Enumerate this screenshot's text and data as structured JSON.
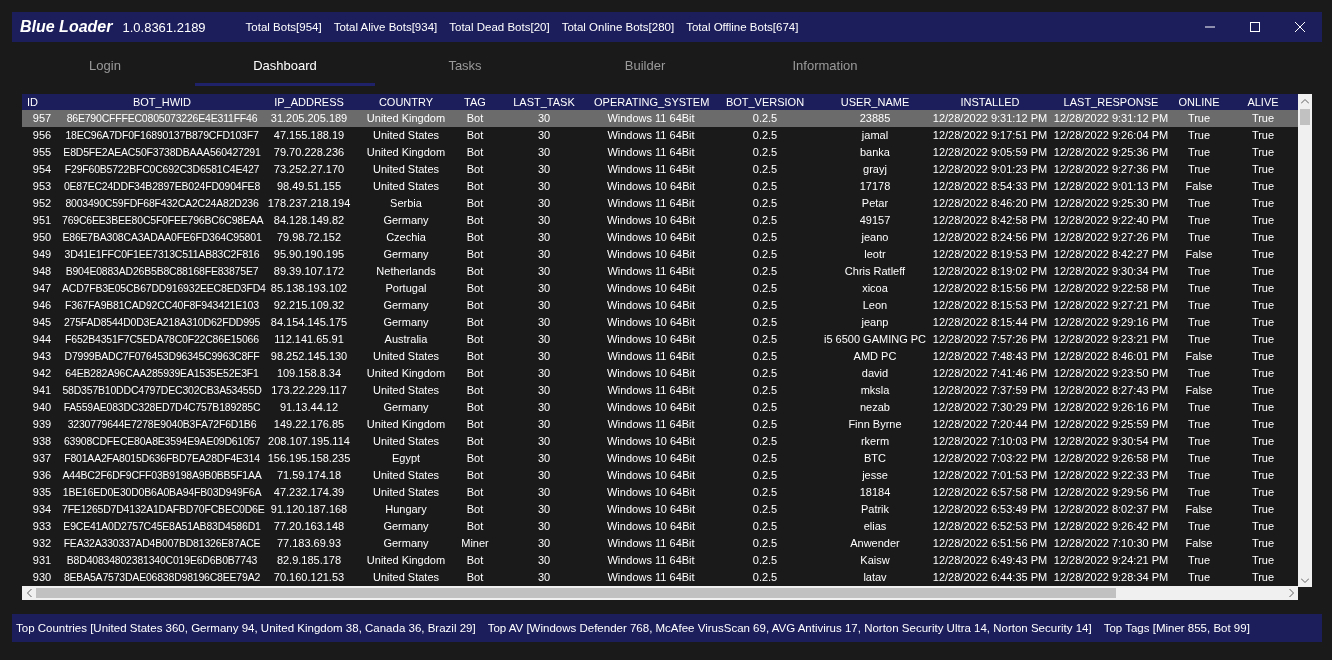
{
  "window": {
    "title": "Blue Loader",
    "version": "1.0.8361.2189",
    "stats": [
      "Total Bots[954]",
      "Total Alive Bots[934]",
      "Total Dead Bots[20]",
      "Total Online Bots[280]",
      "Total Offline Bots[674]"
    ]
  },
  "tabs": [
    {
      "label": "Login",
      "selected": false
    },
    {
      "label": "Dashboard",
      "selected": true
    },
    {
      "label": "Tasks",
      "selected": false
    },
    {
      "label": "Builder",
      "selected": false
    },
    {
      "label": "Information",
      "selected": false
    }
  ],
  "table": {
    "columns": [
      "ID",
      "BOT_HWID",
      "IP_ADDRESS",
      "COUNTRY",
      "TAG",
      "LAST_TASK",
      "OPERATING_SYSTEM",
      "BOT_VERSION",
      "USER_NAME",
      "INSTALLED",
      "LAST_RESPONSE",
      "ONLINE",
      "ALIVE"
    ],
    "rows": [
      {
        "selected": true,
        "cells": [
          "957",
          "86E790CFFFEC0805073226E4E311FF46",
          "31.205.205.189",
          "United Kingdom",
          "Bot",
          "30",
          "Windows 11 64Bit",
          "0.2.5",
          "23885",
          "12/28/2022 9:31:12 PM",
          "12/28/2022 9:31:12 PM",
          "True",
          "True"
        ]
      },
      {
        "selected": false,
        "cells": [
          "956",
          "18EC96A7DF0F16890137B879CFD103F7",
          "47.155.188.19",
          "United States",
          "Bot",
          "30",
          "Windows 11 64Bit",
          "0.2.5",
          "jamal",
          "12/28/2022 9:17:51 PM",
          "12/28/2022 9:26:04 PM",
          "True",
          "True"
        ]
      },
      {
        "selected": false,
        "cells": [
          "955",
          "E8D5FE2AEAC50F3738DBAAA560427291",
          "79.70.228.236",
          "United Kingdom",
          "Bot",
          "30",
          "Windows 11 64Bit",
          "0.2.5",
          "banka",
          "12/28/2022 9:05:59 PM",
          "12/28/2022 9:25:36 PM",
          "True",
          "True"
        ]
      },
      {
        "selected": false,
        "cells": [
          "954",
          "F29F60B5722BFC0C692C3D6581C4E427",
          "73.252.27.170",
          "United States",
          "Bot",
          "30",
          "Windows 11 64Bit",
          "0.2.5",
          "grayj",
          "12/28/2022 9:01:23 PM",
          "12/28/2022 9:27:36 PM",
          "True",
          "True"
        ]
      },
      {
        "selected": false,
        "cells": [
          "953",
          "0E87EC24DDF34B2897EB024FD0904FE8",
          "98.49.51.155",
          "United States",
          "Bot",
          "30",
          "Windows 10 64Bit",
          "0.2.5",
          "17178",
          "12/28/2022 8:54:33 PM",
          "12/28/2022 9:01:13 PM",
          "False",
          "True"
        ]
      },
      {
        "selected": false,
        "cells": [
          "952",
          "8003490C59FDF68F432CA2C24A82D236",
          "178.237.218.194",
          "Serbia",
          "Bot",
          "30",
          "Windows 11 64Bit",
          "0.2.5",
          "Petar",
          "12/28/2022 8:46:20 PM",
          "12/28/2022 9:25:30 PM",
          "True",
          "True"
        ]
      },
      {
        "selected": false,
        "cells": [
          "951",
          "769C6EE3BEE80C5F0FEE796BC6C98EAA",
          "84.128.149.82",
          "Germany",
          "Bot",
          "30",
          "Windows 10 64Bit",
          "0.2.5",
          "49157",
          "12/28/2022 8:42:58 PM",
          "12/28/2022 9:22:40 PM",
          "True",
          "True"
        ]
      },
      {
        "selected": false,
        "cells": [
          "950",
          "E86E7BA308CA3ADAA0FE6FD364C95801",
          "79.98.72.152",
          "Czechia",
          "Bot",
          "30",
          "Windows 10 64Bit",
          "0.2.5",
          "jeano",
          "12/28/2022 8:24:56 PM",
          "12/28/2022 9:27:26 PM",
          "True",
          "True"
        ]
      },
      {
        "selected": false,
        "cells": [
          "949",
          "3D41E1FFC0F1EE7313C511AB83C2F816",
          "95.90.190.195",
          "Germany",
          "Bot",
          "30",
          "Windows 10 64Bit",
          "0.2.5",
          "leotr",
          "12/28/2022 8:19:53 PM",
          "12/28/2022 8:42:27 PM",
          "False",
          "True"
        ]
      },
      {
        "selected": false,
        "cells": [
          "948",
          "B904E0883AD26B5B8C88168FE83875E7",
          "89.39.107.172",
          "Netherlands",
          "Bot",
          "30",
          "Windows 11 64Bit",
          "0.2.5",
          "Chris Ratleff",
          "12/28/2022 8:19:02 PM",
          "12/28/2022 9:30:34 PM",
          "True",
          "True"
        ]
      },
      {
        "selected": false,
        "cells": [
          "947",
          "ACD7FB3E05CB67DD916932EEC8ED3FD4",
          "85.138.193.102",
          "Portugal",
          "Bot",
          "30",
          "Windows 10 64Bit",
          "0.2.5",
          "xicoa",
          "12/28/2022 8:15:56 PM",
          "12/28/2022 9:22:58 PM",
          "True",
          "True"
        ]
      },
      {
        "selected": false,
        "cells": [
          "946",
          "F367FA9B81CAD92CC40F8F943421E103",
          "92.215.109.32",
          "Germany",
          "Bot",
          "30",
          "Windows 10 64Bit",
          "0.2.5",
          "Leon",
          "12/28/2022 8:15:53 PM",
          "12/28/2022 9:27:21 PM",
          "True",
          "True"
        ]
      },
      {
        "selected": false,
        "cells": [
          "945",
          "275FAD8544D0D3EA218A310D62FDD995",
          "84.154.145.175",
          "Germany",
          "Bot",
          "30",
          "Windows 10 64Bit",
          "0.2.5",
          "jeanp",
          "12/28/2022 8:15:44 PM",
          "12/28/2022 9:29:16 PM",
          "True",
          "True"
        ]
      },
      {
        "selected": false,
        "cells": [
          "944",
          "F652B4351F7C5EDA78C0F22C86E15066",
          "112.141.65.91",
          "Australia",
          "Bot",
          "30",
          "Windows 10 64Bit",
          "0.2.5",
          "i5 6500 GAMING PC",
          "12/28/2022 7:57:26 PM",
          "12/28/2022 9:23:21 PM",
          "True",
          "True"
        ]
      },
      {
        "selected": false,
        "cells": [
          "943",
          "D7999BADC7F076453D96345C9963C8FF",
          "98.252.145.130",
          "United States",
          "Bot",
          "30",
          "Windows 11 64Bit",
          "0.2.5",
          "AMD PC",
          "12/28/2022 7:48:43 PM",
          "12/28/2022 8:46:01 PM",
          "False",
          "True"
        ]
      },
      {
        "selected": false,
        "cells": [
          "942",
          "64EB282A96CAA285939EA1535E52E3F1",
          "109.158.8.34",
          "United Kingdom",
          "Bot",
          "30",
          "Windows 10 64Bit",
          "0.2.5",
          "david",
          "12/28/2022 7:41:46 PM",
          "12/28/2022 9:23:50 PM",
          "True",
          "True"
        ]
      },
      {
        "selected": false,
        "cells": [
          "941",
          "58D357B10DDC4797DEC302CB3A53455D",
          "173.22.229.117",
          "United States",
          "Bot",
          "30",
          "Windows 11 64Bit",
          "0.2.5",
          "mksla",
          "12/28/2022 7:37:59 PM",
          "12/28/2022 8:27:43 PM",
          "False",
          "True"
        ]
      },
      {
        "selected": false,
        "cells": [
          "940",
          "FA559AE083DC328ED7D4C757B189285C",
          "91.13.44.12",
          "Germany",
          "Bot",
          "30",
          "Windows 10 64Bit",
          "0.2.5",
          "nezab",
          "12/28/2022 7:30:29 PM",
          "12/28/2022 9:26:16 PM",
          "True",
          "True"
        ]
      },
      {
        "selected": false,
        "cells": [
          "939",
          "3230779644E7278E9040B3FA72F6D1B6",
          "149.22.176.85",
          "United Kingdom",
          "Bot",
          "30",
          "Windows 11 64Bit",
          "0.2.5",
          "Finn Byrne",
          "12/28/2022 7:20:44 PM",
          "12/28/2022 9:25:59 PM",
          "True",
          "True"
        ]
      },
      {
        "selected": false,
        "cells": [
          "938",
          "63908CDFECE80A8E3594E9AE09D61057",
          "208.107.195.114",
          "United States",
          "Bot",
          "30",
          "Windows 10 64Bit",
          "0.2.5",
          "rkerm",
          "12/28/2022 7:10:03 PM",
          "12/28/2022 9:30:54 PM",
          "True",
          "True"
        ]
      },
      {
        "selected": false,
        "cells": [
          "937",
          "F801AA2FA8015D636FBD7EA28DF4E314",
          "156.195.158.235",
          "Egypt",
          "Bot",
          "30",
          "Windows 10 64Bit",
          "0.2.5",
          "BTC",
          "12/28/2022 7:03:22 PM",
          "12/28/2022 9:26:58 PM",
          "True",
          "True"
        ]
      },
      {
        "selected": false,
        "cells": [
          "936",
          "A44BC2F6DF9CFF03B9198A9B0BB5F1AA",
          "71.59.174.18",
          "United States",
          "Bot",
          "30",
          "Windows 10 64Bit",
          "0.2.5",
          "jesse",
          "12/28/2022 7:01:53 PM",
          "12/28/2022 9:22:33 PM",
          "True",
          "True"
        ]
      },
      {
        "selected": false,
        "cells": [
          "935",
          "1BE16ED0E30D0B6A0BA94FB03D949F6A",
          "47.232.174.39",
          "United States",
          "Bot",
          "30",
          "Windows 10 64Bit",
          "0.2.5",
          "18184",
          "12/28/2022 6:57:58 PM",
          "12/28/2022 9:29:56 PM",
          "True",
          "True"
        ]
      },
      {
        "selected": false,
        "cells": [
          "934",
          "7FE1265D7D4132A1DAFBD70FCBEC0D6E",
          "91.120.187.168",
          "Hungary",
          "Bot",
          "30",
          "Windows 10 64Bit",
          "0.2.5",
          "Patrik",
          "12/28/2022 6:53:49 PM",
          "12/28/2022 8:02:37 PM",
          "False",
          "True"
        ]
      },
      {
        "selected": false,
        "cells": [
          "933",
          "E9CE41A0D2757C45E8A51AB83D4586D1",
          "77.20.163.148",
          "Germany",
          "Bot",
          "30",
          "Windows 10 64Bit",
          "0.2.5",
          "elias",
          "12/28/2022 6:52:53 PM",
          "12/28/2022 9:26:42 PM",
          "True",
          "True"
        ]
      },
      {
        "selected": false,
        "cells": [
          "932",
          "FEA32A330337AD4B007BD81326E87ACE",
          "77.183.69.93",
          "Germany",
          "Miner",
          "30",
          "Windows 11 64Bit",
          "0.2.5",
          "Anwender",
          "12/28/2022 6:51:56 PM",
          "12/28/2022 7:10:30 PM",
          "False",
          "True"
        ]
      },
      {
        "selected": false,
        "cells": [
          "931",
          "B8D40834802381340C019E6D6B0B7743",
          "82.9.185.178",
          "United Kingdom",
          "Bot",
          "30",
          "Windows 11 64Bit",
          "0.2.5",
          "Kaisw",
          "12/28/2022 6:49:43 PM",
          "12/28/2022 9:24:21 PM",
          "True",
          "True"
        ]
      },
      {
        "selected": false,
        "cells": [
          "930",
          "8EBA5A7573DAE06838D98196C8EE79A2",
          "70.160.121.53",
          "United States",
          "Bot",
          "30",
          "Windows 11 64Bit",
          "0.2.5",
          "latav",
          "12/28/2022 6:44:35 PM",
          "12/28/2022 9:28:34 PM",
          "True",
          "True"
        ]
      }
    ]
  },
  "status_bar": [
    "Top Countries [United States 360, Germany 94, United Kingdom 38, Canada 36, Brazil 29]",
    "Top AV [Windows Defender 768, McAfee VirusScan 69, AVG Antivirus 17, Norton Security Ultra 14, Norton Security 14]",
    "Top Tags [Miner 855, Bot 99]"
  ]
}
